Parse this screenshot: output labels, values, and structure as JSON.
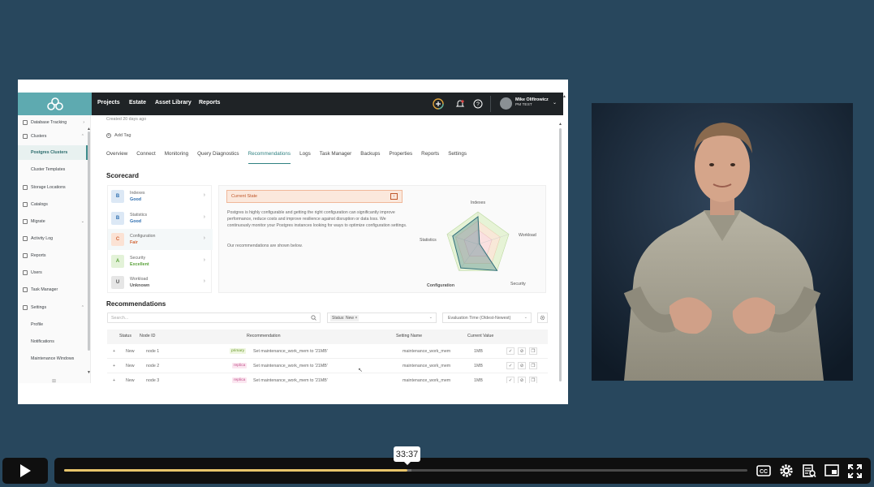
{
  "topnav": {
    "links": [
      "Projects",
      "Estate",
      "Asset Library",
      "Reports"
    ],
    "user_name": "Mike Olifirowicz",
    "user_team": "PM TEST"
  },
  "sidebar": {
    "items": [
      {
        "label": "Database Tracking"
      },
      {
        "label": "Clusters"
      },
      {
        "label": "Postgres Clusters"
      },
      {
        "label": "Cluster Templates"
      },
      {
        "label": "Storage Locations"
      },
      {
        "label": "Catalogs"
      },
      {
        "label": "Migrate"
      },
      {
        "label": "Activity Log"
      },
      {
        "label": "Reports"
      },
      {
        "label": "Users"
      },
      {
        "label": "Task Manager"
      },
      {
        "label": "Settings"
      },
      {
        "label": "Profile"
      },
      {
        "label": "Notifications"
      },
      {
        "label": "Maintenance Windows"
      }
    ]
  },
  "main": {
    "created": "Created 20 days ago",
    "add_tag": "Add Tag",
    "tabs": [
      "Overview",
      "Connect",
      "Monitoring",
      "Query Diagnostics",
      "Recommendations",
      "Logs",
      "Task Manager",
      "Backups",
      "Properties",
      "Reports",
      "Settings"
    ],
    "active_tab": "Recommendations",
    "scorecard_title": "Scorecard",
    "scorecard": [
      {
        "grade": "B",
        "label": "Indexes",
        "value": "Good",
        "color": "#2f6fb0",
        "bg": "#dce8f5"
      },
      {
        "grade": "B",
        "label": "Statistics",
        "value": "Good",
        "color": "#2f6fb0",
        "bg": "#dce8f5"
      },
      {
        "grade": "C",
        "label": "Configuration",
        "value": "Fair",
        "color": "#d2683a",
        "bg": "#fbe2d4"
      },
      {
        "grade": "A",
        "label": "Security",
        "value": "Excellent",
        "color": "#5aa23a",
        "bg": "#e3f2d8"
      },
      {
        "grade": "U",
        "label": "Workload",
        "value": "Unknown",
        "color": "#555555",
        "bg": "#e6e6e6"
      }
    ],
    "current_state_label": "Current State",
    "description": "Postgres is highly configurable and getting the right configuration can significantly improve performance, reduce costs and improve resilience against disruption or data loss. We continuously monitor your Postgres instances looking for ways to optimize configuration settings.",
    "note": "Our recommendations are shown below.",
    "radar_labels": [
      "Indexes",
      "Workload",
      "Security",
      "Configuration",
      "Statistics"
    ],
    "recommendations_title": "Recommendations",
    "search_placeholder": "Search...",
    "status_filter": "Status: New ×",
    "eval_filter": "Evaluation Time (Oldest-Newest)",
    "table_headers": [
      "Status",
      "Node ID",
      "Recommendation",
      "Setting Name",
      "Current Value"
    ],
    "rows": [
      {
        "status": "New",
        "node": "node 1",
        "role": "primary",
        "recommendation": "Set maintenance_work_mem to '21MB'",
        "setting": "maintenance_work_mem",
        "value": "1MB"
      },
      {
        "status": "New",
        "node": "node 2",
        "role": "replica",
        "recommendation": "Set maintenance_work_mem to '21MB'",
        "setting": "maintenance_work_mem",
        "value": "1MB"
      },
      {
        "status": "New",
        "node": "node 3",
        "role": "replica",
        "recommendation": "Set maintenance_work_mem to '21MB'",
        "setting": "maintenance_work_mem",
        "value": "1MB"
      }
    ]
  },
  "player": {
    "time": "33:37",
    "progress": 0.502,
    "buffered": 0.508
  }
}
